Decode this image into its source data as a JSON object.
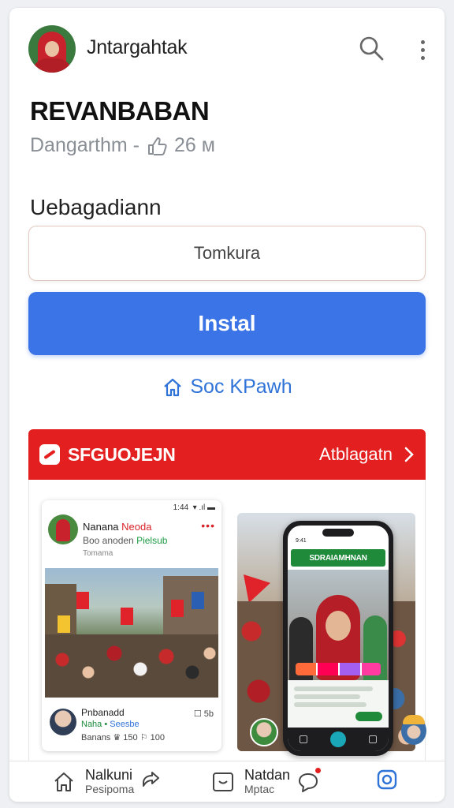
{
  "header": {
    "username": "Jntargahtak",
    "search_icon": "search-icon",
    "menu_icon": "more-vertical-icon"
  },
  "app": {
    "title": "REVANBABAN",
    "developer": "Dangarthm -",
    "rating": "26 м",
    "section_heading": "Uebagadiann"
  },
  "actions": {
    "secondary_label": "Tomkura",
    "install_label": "Instal",
    "link_label": "Soc KPawh"
  },
  "banner": {
    "title": "SFGUOJEJN",
    "link_label": "Atblagatn",
    "color": "#e3201f"
  },
  "screenshot_post": {
    "status_time": "1:44",
    "status_icons": "▾ .ıl ▬",
    "author": "Nanana",
    "author_tag": "Neoda",
    "subtitle": "Boo anoden",
    "subtitle_tag": "Pielsub",
    "meta": "Tomama",
    "footer_name": "Pnbanadd",
    "footer_sub": "Naha •",
    "footer_sub_tag": "Seesbe",
    "footer_stats": "Banans ♛ 150 ⚐ 100",
    "footer_badge": "☐ 5b"
  },
  "screenshot_phone": {
    "title": "SDRAIAMHNAN",
    "status": "9:41"
  },
  "bottom_nav": {
    "item1_label": "Nalkuni",
    "item1_sub": "Pesipoma",
    "item2_label": "Natdan",
    "item2_sub": "Mptac"
  },
  "colors": {
    "accent": "#3b74e6",
    "link": "#2f73d8",
    "banner": "#e3201f"
  }
}
